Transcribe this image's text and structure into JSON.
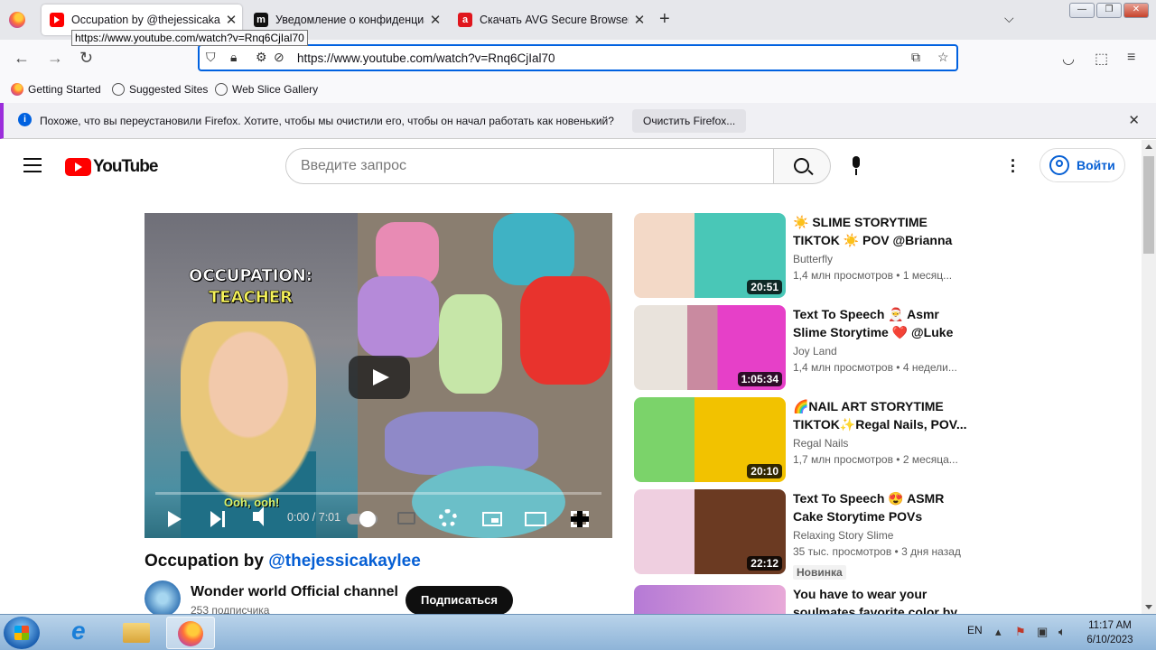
{
  "browser": {
    "tabs": [
      {
        "label": "Occupation by @thejessicakaylee",
        "favicon": "youtube-icon",
        "active": true
      },
      {
        "label": "Уведомление о конфиденциальности",
        "favicon": "m-icon",
        "active": false
      },
      {
        "label": "Скачать AVG Secure Browser",
        "favicon": "avg-icon",
        "active": false
      }
    ],
    "tooltip": "https://www.youtube.com/watch?v=Rnq6CjIal70",
    "url": "https://www.youtube.com/watch?v=Rnq6CjIal70",
    "bookmarks": [
      "Getting Started",
      "Suggested Sites",
      "Web Slice Gallery"
    ],
    "notification": {
      "text": "Похоже, что вы переустановили Firefox. Хотите, чтобы мы очистили его, чтобы он начал работать как новенький?",
      "button": "Очистить Firefox..."
    }
  },
  "youtube": {
    "logo_text": "YouTube",
    "search_placeholder": "Введите запрос",
    "sign_in": "Войти",
    "player": {
      "overlay_line1": "OCCUPATION:",
      "overlay_line2": "TEACHER",
      "caption": "Ooh, ooh!",
      "time": "0:00 / 7:01",
      "progress": 0
    },
    "video": {
      "title_prefix": "Occupation by ",
      "title_handle": "@thejessicakaylee",
      "channel": "Wonder world Official channel",
      "subscribers": "253 подписчика",
      "subscribe": "Подписаться"
    },
    "recommendations": [
      {
        "title": "☀️ SLIME STORYTIME TIKTOK ☀️ POV @Brianna Mizura I...",
        "channel": "Butterfly",
        "meta": "1,4 млн просмотров • 1 месяц...",
        "duration": "20:51"
      },
      {
        "title": "Text To Speech 🎅 Asmr Slime Storytime ❤️ @Luke Davidson...",
        "channel": "Joy Land",
        "meta": "1,4 млн просмотров • 4 недели...",
        "duration": "1:05:34"
      },
      {
        "title": "🌈NAIL ART STORYTIME TIKTOK✨Regal Nails, POV...",
        "channel": "Regal Nails",
        "meta": "1,7 млн просмотров • 2 месяца...",
        "duration": "20:10"
      },
      {
        "title": "Text To Speech 😍 ASMR Cake Storytime POVs @Brianna...",
        "channel": "Relaxing Story Slime",
        "meta": "35 тыс. просмотров • 3 дня назад",
        "duration": "22:12",
        "badge": "Новинка"
      },
      {
        "title": "You have to wear your soulmates favorite color by th...",
        "channel": "",
        "meta": "",
        "duration": ""
      }
    ]
  },
  "taskbar": {
    "lang": "EN",
    "time": "11:17 AM",
    "date": "6/10/2023"
  }
}
